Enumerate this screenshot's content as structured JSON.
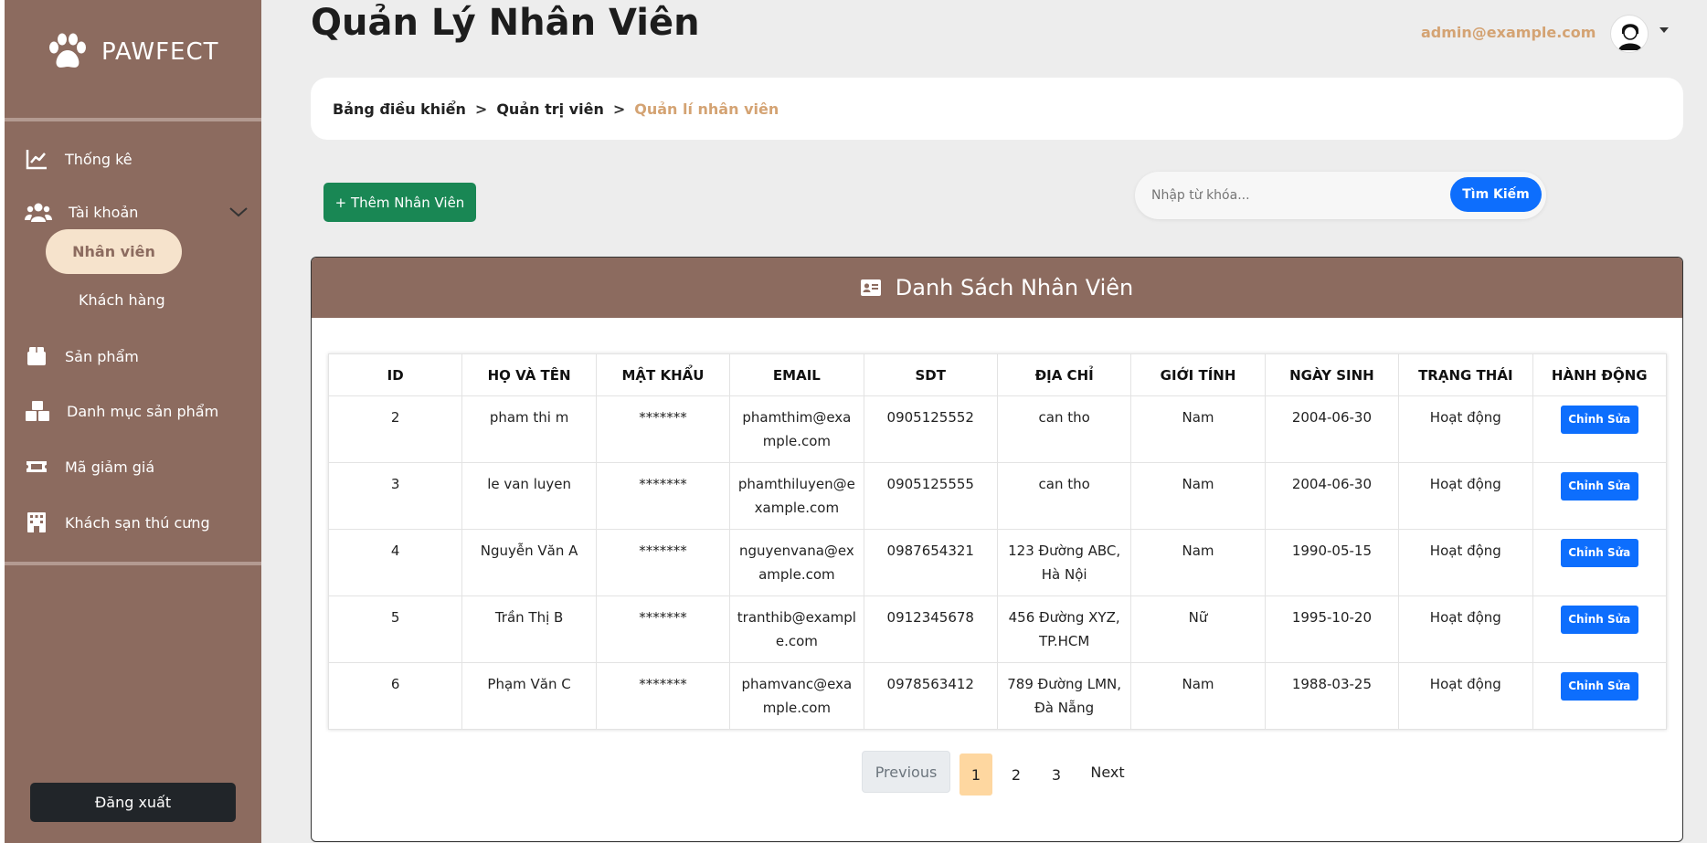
{
  "brand": {
    "name": "PAWFECT"
  },
  "sidebar": {
    "items": [
      {
        "label": "Thống kê",
        "icon": "chart-line-icon"
      },
      {
        "label": "Tài khoản",
        "icon": "users-icon"
      },
      {
        "label": "Sản phẩm",
        "icon": "box-icon"
      },
      {
        "label": "Danh mục sản phẩm",
        "icon": "boxes-icon"
      },
      {
        "label": "Mã giảm giá",
        "icon": "ticket-icon"
      },
      {
        "label": "Khách sạn thú cưng",
        "icon": "hotel-icon"
      }
    ],
    "sub_items": [
      {
        "label": "Nhân viên",
        "active": true
      },
      {
        "label": "Khách hàng",
        "active": false
      }
    ],
    "logout_label": "Đăng xuất"
  },
  "header": {
    "title": "Quản Lý Nhân Viên",
    "admin_email": "admin@example.com"
  },
  "breadcrumb": {
    "items": [
      "Bảng điều khiển",
      "Quản trị viên",
      "Quản lí nhân viên"
    ],
    "separator": ">"
  },
  "toolbar": {
    "add_label": "+ Thêm Nhân Viên",
    "search_placeholder": "Nhập từ khóa...",
    "search_label": "Tìm Kiếm"
  },
  "card": {
    "title": "Danh Sách Nhân Viên"
  },
  "table": {
    "columns": [
      "ID",
      "HỌ VÀ TÊN",
      "MẬT KHẨU",
      "EMAIL",
      "SDT",
      "ĐỊA CHỈ",
      "GIỚI TÍNH",
      "NGÀY SINH",
      "TRẠNG THÁI",
      "HÀNH ĐỘNG"
    ],
    "rows": [
      {
        "id": "2",
        "name": "pham thi m",
        "password": "*******",
        "email": "phamthim@example.com",
        "phone": "0905125552",
        "address": "can tho",
        "gender": "Nam",
        "dob": "2004-06-30",
        "status": "Hoạt động",
        "action": "Chỉnh Sửa"
      },
      {
        "id": "3",
        "name": "le van luyen",
        "password": "*******",
        "email": "phamthiluyen@example.com",
        "phone": "0905125555",
        "address": "can tho",
        "gender": "Nam",
        "dob": "2004-06-30",
        "status": "Hoạt động",
        "action": "Chỉnh Sửa"
      },
      {
        "id": "4",
        "name": "Nguyễn Văn A",
        "password": "*******",
        "email": "nguyenvana@example.com",
        "phone": "0987654321",
        "address": "123 Đường ABC, Hà Nội",
        "gender": "Nam",
        "dob": "1990-05-15",
        "status": "Hoạt động",
        "action": "Chỉnh Sửa"
      },
      {
        "id": "5",
        "name": "Trần Thị B",
        "password": "*******",
        "email": "tranthib@example.com",
        "phone": "0912345678",
        "address": "456 Đường XYZ, TP.HCM",
        "gender": "Nữ",
        "dob": "1995-10-20",
        "status": "Hoạt động",
        "action": "Chỉnh Sửa"
      },
      {
        "id": "6",
        "name": "Phạm Văn C",
        "password": "*******",
        "email": "phamvanc@example.com",
        "phone": "0978563412",
        "address": "789 Đường LMN, Đà Nẵng",
        "gender": "Nam",
        "dob": "1988-03-25",
        "status": "Hoạt động",
        "action": "Chỉnh Sửa"
      }
    ]
  },
  "pagination": {
    "previous_label": "Previous",
    "pages": [
      "1",
      "2",
      "3"
    ],
    "current_page": "1",
    "next_label": "Next"
  },
  "colors": {
    "sidebar_bg": "#8c6b5f",
    "accent": "#d4a373",
    "primary": "#0d6efd",
    "success": "#198754",
    "active_pill": "#f6e3cc"
  }
}
